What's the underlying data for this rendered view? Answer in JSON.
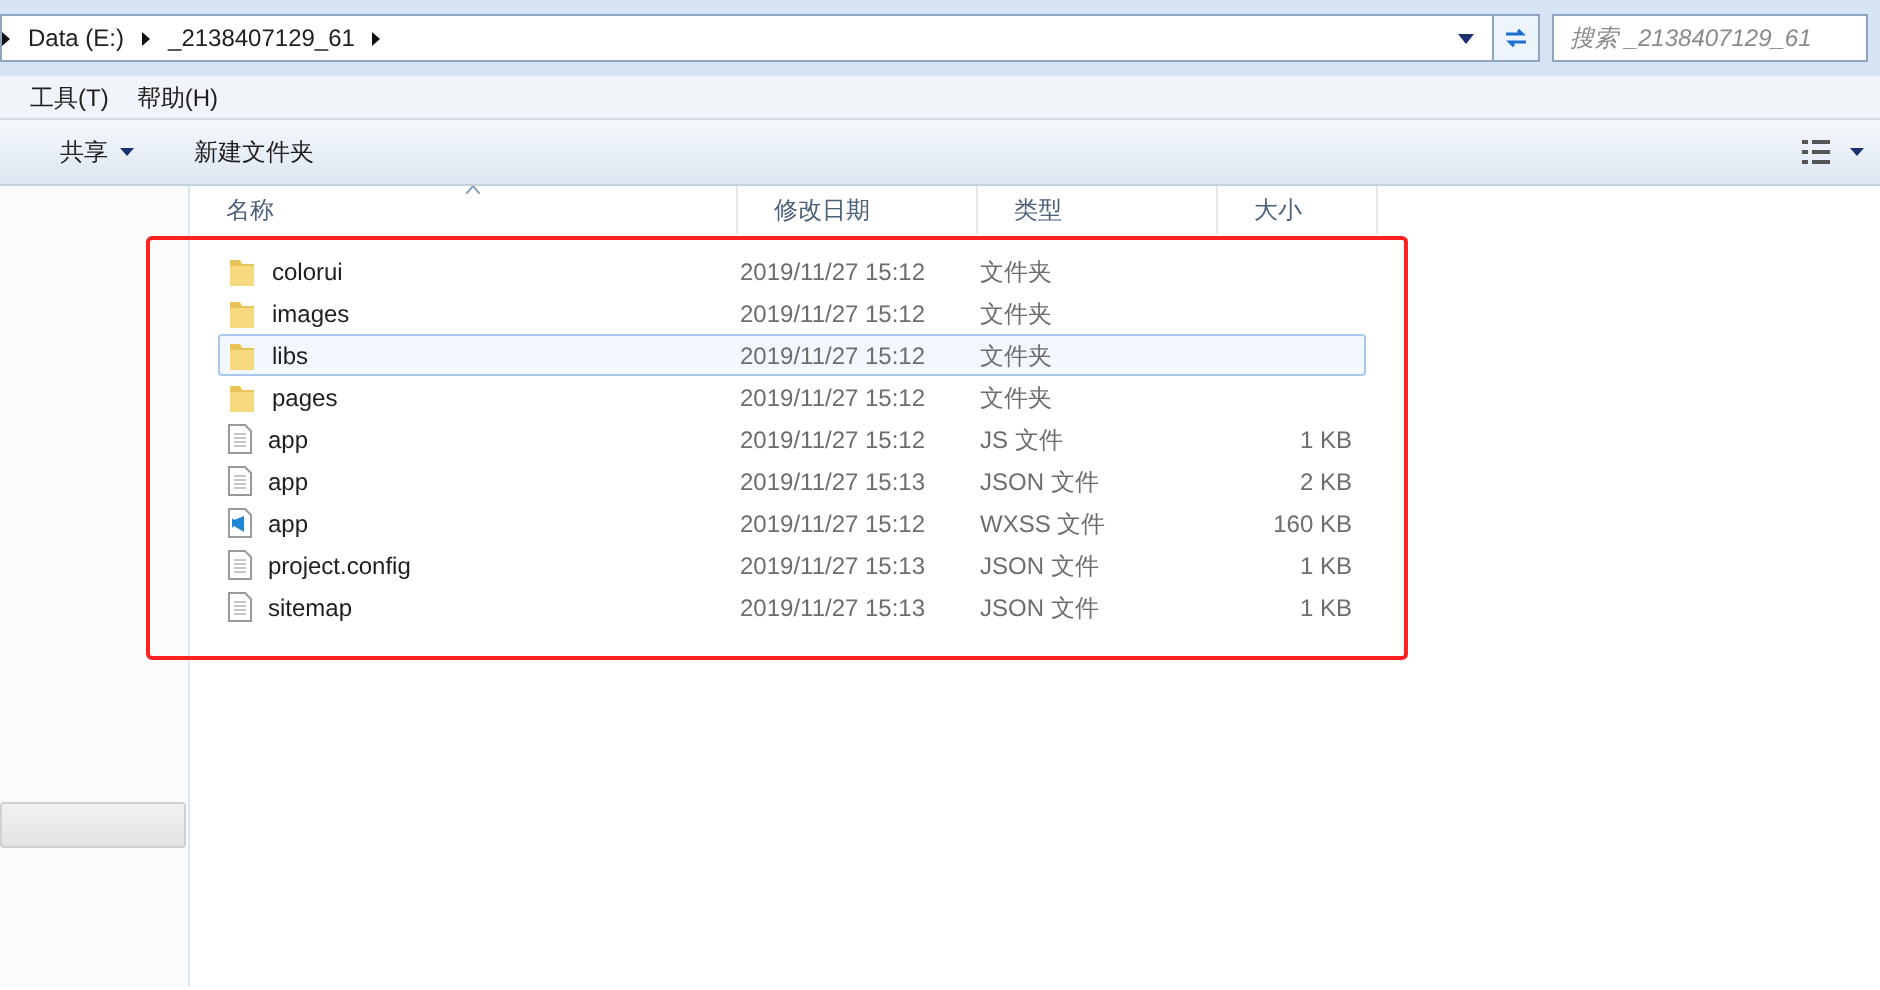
{
  "address_bar": {
    "crumbs": [
      "Data (E:)",
      "_2138407129_61"
    ]
  },
  "search": {
    "placeholder": "搜索 _2138407129_61"
  },
  "menu": [
    "工具(T)",
    "帮助(H)"
  ],
  "toolbar": {
    "share": "共享",
    "new_folder": "新建文件夹"
  },
  "table": {
    "columns": [
      "名称",
      "修改日期",
      "类型",
      "大小"
    ],
    "rows": [
      {
        "kind": "folder",
        "name": "colorui",
        "modified": "2019/11/27 15:12",
        "type": "文件夹",
        "size": "",
        "selected": false
      },
      {
        "kind": "folder",
        "name": "images",
        "modified": "2019/11/27 15:12",
        "type": "文件夹",
        "size": "",
        "selected": false
      },
      {
        "kind": "folder",
        "name": "libs",
        "modified": "2019/11/27 15:12",
        "type": "文件夹",
        "size": "",
        "selected": true
      },
      {
        "kind": "folder",
        "name": "pages",
        "modified": "2019/11/27 15:12",
        "type": "文件夹",
        "size": "",
        "selected": false
      },
      {
        "kind": "file",
        "name": "app",
        "modified": "2019/11/27 15:12",
        "type": "JS 文件",
        "size": "1 KB",
        "selected": false
      },
      {
        "kind": "file",
        "name": "app",
        "modified": "2019/11/27 15:13",
        "type": "JSON 文件",
        "size": "2 KB",
        "selected": false
      },
      {
        "kind": "code",
        "name": "app",
        "modified": "2019/11/27 15:12",
        "type": "WXSS 文件",
        "size": "160 KB",
        "selected": false
      },
      {
        "kind": "file",
        "name": "project.config",
        "modified": "2019/11/27 15:13",
        "type": "JSON 文件",
        "size": "1 KB",
        "selected": false
      },
      {
        "kind": "file",
        "name": "sitemap",
        "modified": "2019/11/27 15:13",
        "type": "JSON 文件",
        "size": "1 KB",
        "selected": false
      }
    ]
  }
}
